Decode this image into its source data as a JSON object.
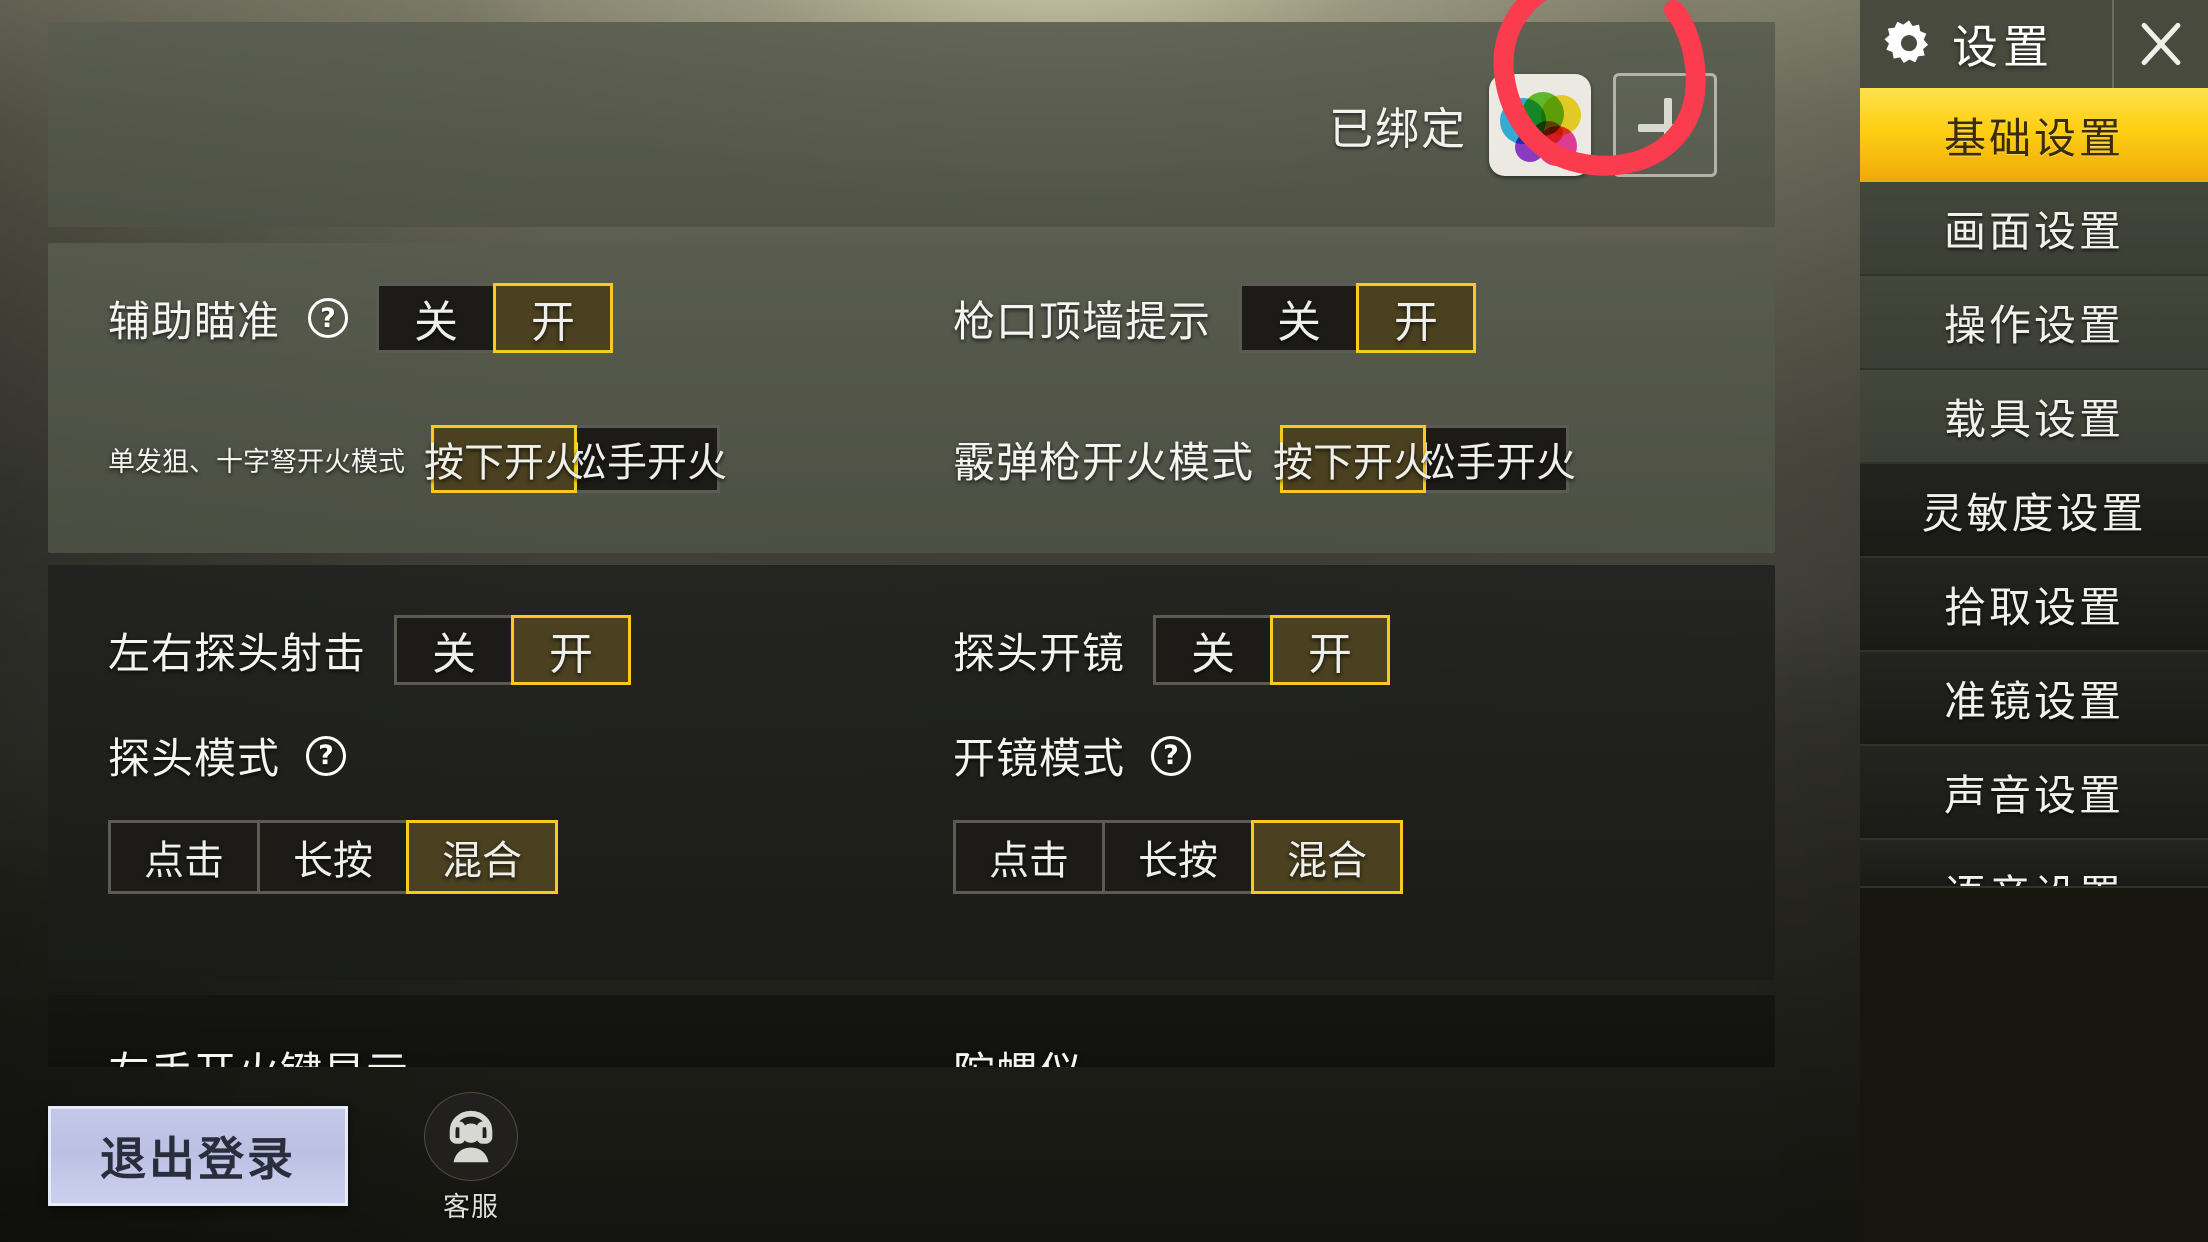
{
  "account": {
    "bound_label": "已绑定",
    "gamecenter_icon": "gamecenter-bubbles-icon",
    "add_icon": "plus-icon"
  },
  "sections": [
    {
      "id": "aim-section",
      "rows": [
        {
          "label": "辅助瞄准",
          "has_help": true,
          "help_glyph": "?",
          "options": [
            "关",
            "开"
          ],
          "selected": 1,
          "style": "onoff",
          "column": "left"
        },
        {
          "label": "枪口顶墙提示",
          "has_help": false,
          "options": [
            "关",
            "开"
          ],
          "selected": 1,
          "style": "onoff",
          "column": "right"
        },
        {
          "label": "单发狙、十字弩开火模式",
          "has_help": false,
          "options": [
            "按下开火",
            "松手开火"
          ],
          "selected": 0,
          "style": "fire",
          "column": "left"
        },
        {
          "label": "霰弹枪开火模式",
          "has_help": false,
          "options": [
            "按下开火",
            "松手开火"
          ],
          "selected": 0,
          "style": "fire",
          "column": "right"
        }
      ]
    },
    {
      "id": "peek-section",
      "rows": [
        {
          "label": "左右探头射击",
          "has_help": false,
          "options": [
            "关",
            "开"
          ],
          "selected": 1,
          "style": "onoff",
          "column": "left"
        },
        {
          "label": "探头开镜",
          "has_help": false,
          "options": [
            "关",
            "开"
          ],
          "selected": 1,
          "style": "onoff",
          "column": "right"
        },
        {
          "label": "探头模式",
          "has_help": true,
          "help_glyph": "?",
          "options": [
            "点击",
            "长按",
            "混合"
          ],
          "selected": 2,
          "style": "mode",
          "column": "left"
        },
        {
          "label": "开镜模式",
          "has_help": true,
          "help_glyph": "?",
          "options": [
            "点击",
            "长按",
            "混合"
          ],
          "selected": 2,
          "style": "mode",
          "column": "right"
        }
      ]
    },
    {
      "id": "cutoff-section",
      "rows": [
        {
          "label": "左手开火键显示",
          "column": "left"
        },
        {
          "label": "陀螺仪",
          "column": "right"
        }
      ]
    }
  ],
  "bottom": {
    "logout_label": "退出登录",
    "service_label": "客服",
    "service_icon": "headset-support-icon"
  },
  "sidebar": {
    "title": "设置",
    "gear_icon": "gear-icon",
    "close_icon": "close-x-icon",
    "items": [
      {
        "label": "基础设置",
        "active": true
      },
      {
        "label": "画面设置",
        "active": false
      },
      {
        "label": "操作设置",
        "active": false
      },
      {
        "label": "载具设置",
        "active": false
      },
      {
        "label": "灵敏度设置",
        "active": false
      },
      {
        "label": "拾取设置",
        "active": false
      },
      {
        "label": "准镜设置",
        "active": false
      },
      {
        "label": "声音设置",
        "active": false
      },
      {
        "label": "语音设置",
        "active": false
      }
    ]
  },
  "annotation": {
    "type": "hand-drawn-circle",
    "color": "#fb3b4e"
  },
  "colors": {
    "accent_gold": "#f7ca1d",
    "selected_fill": "#4b4020",
    "unselected_fill": "#1c1b17",
    "sidebar_active_top": "#ffe14d",
    "sidebar_active_bottom": "#f0a80a",
    "logout_button": "#c4c8e8",
    "annotation_red": "#fb3b4e"
  }
}
